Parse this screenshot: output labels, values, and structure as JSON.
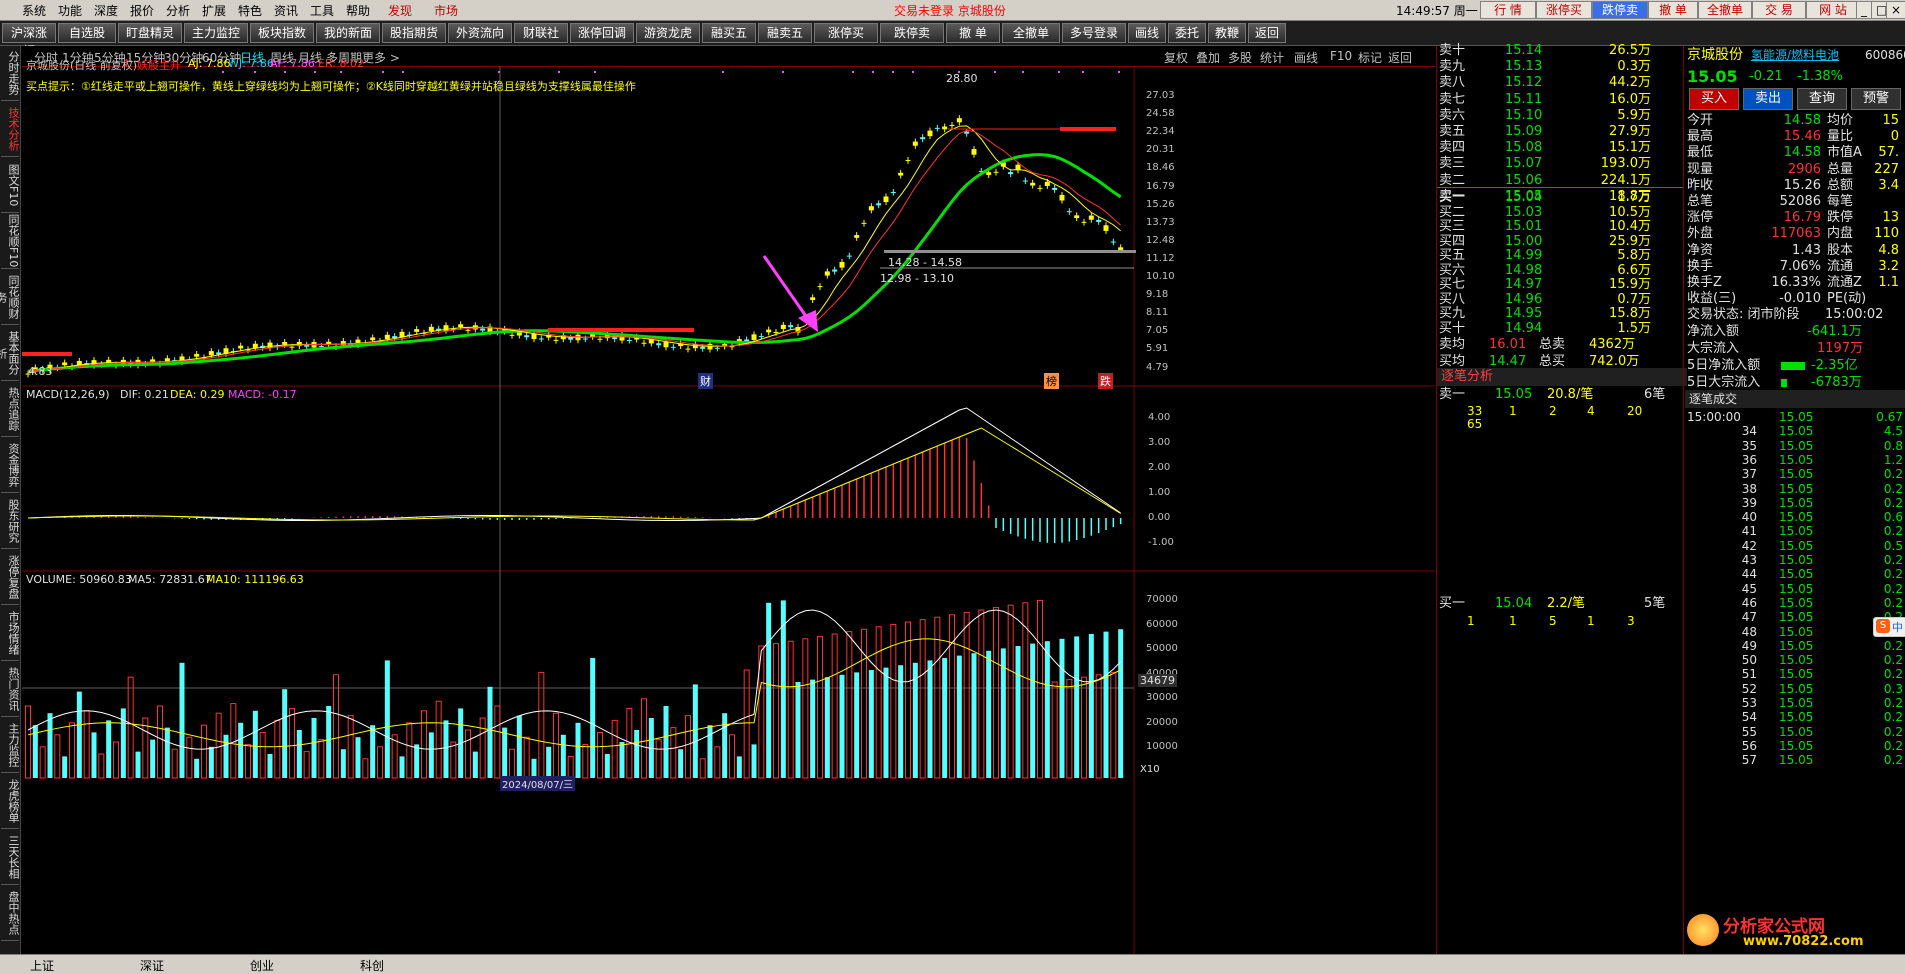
{
  "menu": {
    "items": [
      "系统",
      "功能",
      "深度",
      "报价",
      "分析",
      "扩展",
      "特色",
      "资讯",
      "工具",
      "帮助"
    ],
    "discover": "发现",
    "market": "市场",
    "title": "交易未登录  京城股份",
    "time": "14:49:57 周一",
    "right_buttons": [
      "行 情",
      "涨停买",
      "跌停卖",
      "撤 单",
      "全撤单",
      "交 易",
      "网 站"
    ]
  },
  "toolbar": {
    "items": [
      "沪深涨幅",
      "自选股",
      "盯盘精灵",
      "主力监控",
      "板块指数",
      "我的新面",
      "股指期货",
      "外资流向",
      "财联社",
      "涨停回调",
      "游资龙虎",
      "融买五",
      "融卖五",
      "涨停买",
      "跌停卖",
      "撤 单",
      "全撤单",
      "多号登录",
      "画线",
      "委托",
      "教鞭",
      "返回"
    ]
  },
  "left_tabs": [
    "分时走势",
    "技术分析",
    "图文F10",
    "同花顺F10",
    "同花顺财务",
    "基本面分析",
    "热点追踪",
    "资金博弈",
    "股东研究",
    "涨停复盘",
    "市场情绪",
    "热门资讯",
    "主力监控",
    "龙虎榜单",
    "三天长相",
    "盘中热点"
  ],
  "period": {
    "items": [
      "分时",
      "1分钟",
      "5分钟",
      "15分钟",
      "30分钟",
      "60分钟",
      "日线",
      "周线",
      "月线",
      "多周期",
      "更多 >"
    ],
    "active": "日线",
    "right_items": [
      "复权",
      "叠加",
      "多股",
      "统计",
      "画线",
      "F10",
      "标记",
      "返回"
    ]
  },
  "main_chart": {
    "stock_title": "京城股份(日线 前复权)",
    "indicator": "妖股主升",
    "aj": "AJ: 7.86",
    "wj": "WJ: 7.86",
    "af": "AF: 7.86",
    "er": "ER: 8.02",
    "buy_tip": "买点提示：①红线走平或上翘可操作，黄线上穿绿线均为上翘可操作；②K线同时穿越红黄绿并站稳且绿线为支撑线属最佳操作",
    "high_label": "28.80",
    "low_label": "4.83",
    "range1": "14.28 - 14.58",
    "range2": "12.98 - 13.10",
    "price_ticks": [
      "27.03",
      "24.58",
      "22.34",
      "20.31",
      "18.46",
      "16.79",
      "15.26",
      "13.73",
      "12.48",
      "11.12",
      "10.10",
      "9.18",
      "8.11",
      "7.05",
      "5.91",
      "4.79"
    ],
    "event_cai": "财",
    "event_bang": "榜",
    "event_die": "跌"
  },
  "macd": {
    "title": "MACD(12,26,9)",
    "dif": "DIF: 0.21",
    "dea": "DEA: 0.29",
    "macd": "MACD: -0.17",
    "ticks": [
      "4.00",
      "3.00",
      "2.00",
      "1.00",
      "0.00",
      "-1.00"
    ]
  },
  "volume": {
    "title": "VOLUME: 50960.83",
    "ma5": "MA5: 72831.67",
    "ma10": "MA10: 111196.63",
    "ticks": [
      "70000",
      "60000",
      "50000",
      "40000",
      "30000",
      "20000",
      "10000"
    ],
    "cursor_value": "34679",
    "unit": "X10",
    "date_label": "2024/08/07/三"
  },
  "colors": {
    "red": "#ff3232",
    "green": "#00e000",
    "yellow": "#ffff00",
    "cyan": "#55ffff",
    "magenta": "#ff40ff"
  },
  "order_book": {
    "sell": [
      {
        "label": "卖十",
        "price": "15.14",
        "vol": "26.5万"
      },
      {
        "label": "卖九",
        "price": "15.13",
        "vol": "0.3万"
      },
      {
        "label": "卖八",
        "price": "15.12",
        "vol": "44.2万"
      },
      {
        "label": "卖七",
        "price": "15.11",
        "vol": "16.0万"
      },
      {
        "label": "卖六",
        "price": "15.10",
        "vol": "5.9万"
      },
      {
        "label": "卖五",
        "price": "15.09",
        "vol": "27.9万"
      },
      {
        "label": "卖四",
        "price": "15.08",
        "vol": "15.1万"
      },
      {
        "label": "卖三",
        "price": "15.07",
        "vol": "193.0万"
      },
      {
        "label": "卖二",
        "price": "15.06",
        "vol": "224.1万"
      },
      {
        "label": "卖一",
        "price": "15.05",
        "vol": "18.8万"
      }
    ],
    "buy": [
      {
        "label": "买一",
        "price": "15.04",
        "vol": "1.7万"
      },
      {
        "label": "买二",
        "price": "15.03",
        "vol": "10.5万"
      },
      {
        "label": "买三",
        "price": "15.01",
        "vol": "10.4万"
      },
      {
        "label": "买四",
        "price": "15.00",
        "vol": "25.9万"
      },
      {
        "label": "买五",
        "price": "14.99",
        "vol": "5.8万"
      },
      {
        "label": "买六",
        "price": "14.98",
        "vol": "6.6万"
      },
      {
        "label": "买七",
        "price": "14.97",
        "vol": "15.9万"
      },
      {
        "label": "买八",
        "price": "14.96",
        "vol": "0.7万"
      },
      {
        "label": "买九",
        "price": "14.95",
        "vol": "15.8万"
      },
      {
        "label": "买十",
        "price": "14.94",
        "vol": "1.5万"
      }
    ],
    "avg_sell_label": "卖均",
    "avg_sell": "16.01",
    "total_sell_label": "总卖",
    "total_sell": "4362万",
    "avg_buy_label": "买均",
    "avg_buy": "14.47",
    "total_buy_label": "总买",
    "total_buy": "742.0万",
    "zhubi_title": "逐笔分析",
    "sell1_row": {
      "label": "卖一",
      "price": "15.05",
      "vol": "20.8/笔",
      "count": "6笔"
    },
    "sell1_detail": [
      "33",
      "1",
      "2",
      "4",
      "20"
    ],
    "sell1_detail2": "65",
    "buy1_row": {
      "label": "买一",
      "price": "15.04",
      "vol": "2.2/笔",
      "count": "5笔"
    },
    "buy1_detail": [
      "1",
      "1",
      "5",
      "1",
      "3"
    ]
  },
  "quote": {
    "name": "京城股份",
    "concept": "氢能源/燃料电池",
    "code": "600860",
    "price": "15.05",
    "change": "-0.21",
    "pct": "-1.38%",
    "buttons": [
      "买入",
      "卖出",
      "查询",
      "预警"
    ],
    "fields": [
      {
        "k1": "今开",
        "v1": "14.58",
        "k2": "均价",
        "v2": "15"
      },
      {
        "k1": "最高",
        "v1": "15.46",
        "k2": "量比",
        "v2": "0"
      },
      {
        "k1": "最低",
        "v1": "14.58",
        "k2": "市值A",
        "v2": "57."
      },
      {
        "k1": "现量",
        "v1": "2906",
        "k2": "总量",
        "v2": "227"
      },
      {
        "k1": "昨收",
        "v1": "15.26",
        "k2": "总额",
        "v2": "3.4"
      },
      {
        "k1": "总笔",
        "v1": "52086",
        "k2": "每笔",
        "v2": ""
      },
      {
        "k1": "涨停",
        "v1": "16.79",
        "k2": "跌停",
        "v2": "13"
      },
      {
        "k1": "外盘",
        "v1": "117063",
        "k2": "内盘",
        "v2": "110"
      },
      {
        "k1": "净资",
        "v1": "1.43",
        "k2": "股本",
        "v2": "4.8"
      },
      {
        "k1": "换手",
        "v1": "7.06%",
        "k2": "流通",
        "v2": "3.2"
      },
      {
        "k1": "换手Z",
        "v1": "16.33%",
        "k2": "流通Z",
        "v2": "1.1"
      },
      {
        "k1": "收益(三)",
        "v1": "-0.010",
        "k2": "PE(动)",
        "v2": ""
      }
    ],
    "trade_state": "交易状态: 闭市阶段",
    "trade_time": "15:00:02",
    "net_inflow_label": "净流入额",
    "net_inflow": "-641.1万",
    "block_inflow_label": "大宗流入",
    "block_inflow": "1197万",
    "net5_label": "5日净流入额",
    "net5": "-2.35亿",
    "block5_label": "5日大宗流入",
    "block5": "-6783万"
  },
  "ticks_panel": {
    "title": "逐笔成交",
    "rows": [
      {
        "t": "15:00:00",
        "p": "15.05",
        "v": "0.67"
      },
      {
        "t": "34",
        "p": "15.05",
        "v": "4.5"
      },
      {
        "t": "35",
        "p": "15.05",
        "v": "0.8"
      },
      {
        "t": "36",
        "p": "15.05",
        "v": "1.2"
      },
      {
        "t": "37",
        "p": "15.05",
        "v": "0.2"
      },
      {
        "t": "38",
        "p": "15.05",
        "v": "0.2"
      },
      {
        "t": "39",
        "p": "15.05",
        "v": "0.2"
      },
      {
        "t": "40",
        "p": "15.05",
        "v": "0.6"
      },
      {
        "t": "41",
        "p": "15.05",
        "v": "0.2"
      },
      {
        "t": "42",
        "p": "15.05",
        "v": "0.5"
      },
      {
        "t": "43",
        "p": "15.05",
        "v": "0.2"
      },
      {
        "t": "44",
        "p": "15.05",
        "v": "0.2"
      },
      {
        "t": "45",
        "p": "15.05",
        "v": "0.2"
      },
      {
        "t": "46",
        "p": "15.05",
        "v": "0.2"
      },
      {
        "t": "47",
        "p": "15.05",
        "v": "0.2"
      },
      {
        "t": "48",
        "p": "15.05",
        "v": "0.2"
      },
      {
        "t": "49",
        "p": "15.05",
        "v": "0.2"
      },
      {
        "t": "50",
        "p": "15.05",
        "v": "0.2"
      },
      {
        "t": "51",
        "p": "15.05",
        "v": "0.2"
      },
      {
        "t": "52",
        "p": "15.05",
        "v": "0.3"
      },
      {
        "t": "53",
        "p": "15.05",
        "v": "0.2"
      },
      {
        "t": "54",
        "p": "15.05",
        "v": "0.2"
      },
      {
        "t": "55",
        "p": "15.05",
        "v": "0.2"
      },
      {
        "t": "56",
        "p": "15.05",
        "v": "0.2"
      },
      {
        "t": "57",
        "p": "15.05",
        "v": "0.2"
      }
    ]
  },
  "ime": {
    "label": "中"
  },
  "watermark": {
    "site": "分析家公式网",
    "url": "www.70822.com"
  },
  "status": {
    "items": [
      "上证",
      "深证",
      "创业",
      "科创"
    ]
  }
}
